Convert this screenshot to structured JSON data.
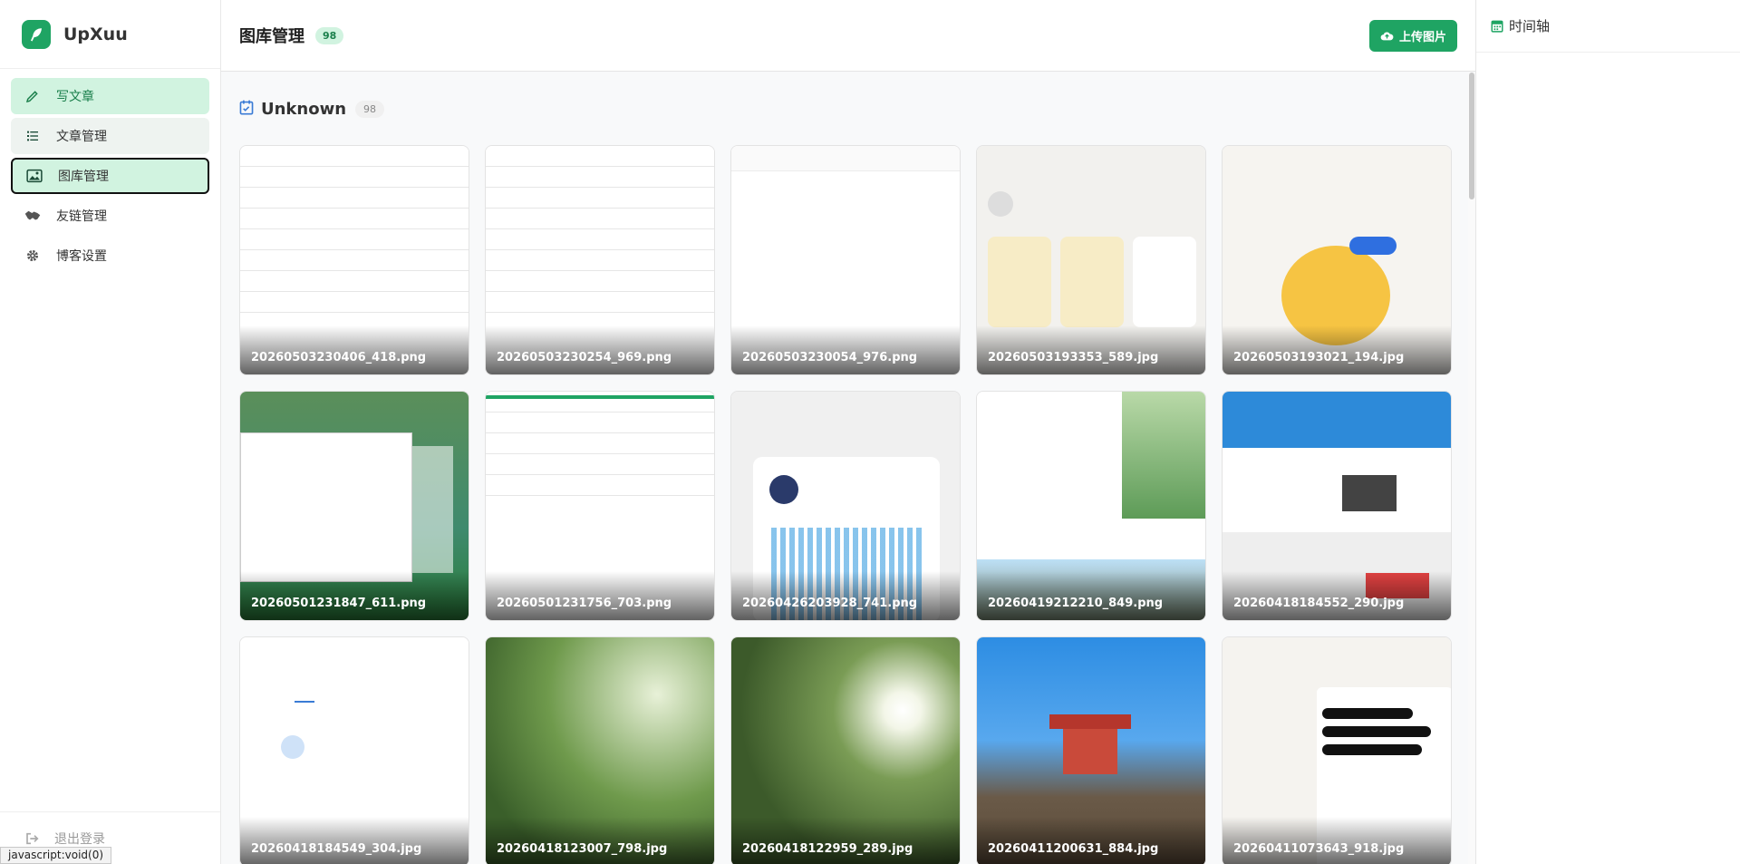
{
  "sidebar": {
    "brand": "UpXuu",
    "items": [
      {
        "label": "写文章",
        "key": "write"
      },
      {
        "label": "文章管理",
        "key": "posts"
      },
      {
        "label": "图库管理",
        "key": "gallery"
      },
      {
        "label": "友链管理",
        "key": "links"
      },
      {
        "label": "博客设置",
        "key": "settings"
      }
    ],
    "logout": "退出登录"
  },
  "statusbar": "javascript:void(0)",
  "header": {
    "title": "图库管理",
    "count": "98",
    "upload_label": "上传图片"
  },
  "group": {
    "title": "Unknown",
    "count": "98"
  },
  "images": [
    {
      "name": "20260503230406_418.png"
    },
    {
      "name": "20260503230254_969.png"
    },
    {
      "name": "20260503230054_976.png"
    },
    {
      "name": "20260503193353_589.jpg"
    },
    {
      "name": "20260503193021_194.jpg"
    },
    {
      "name": "20260501231847_611.png"
    },
    {
      "name": "20260501231756_703.png"
    },
    {
      "name": "20260426203928_741.png"
    },
    {
      "name": "20260419212210_849.png"
    },
    {
      "name": "20260418184552_290.jpg"
    },
    {
      "name": "20260418184549_304.jpg"
    },
    {
      "name": "20260418123007_798.jpg"
    },
    {
      "name": "20260418122959_289.jpg"
    },
    {
      "name": "20260411200631_884.jpg"
    },
    {
      "name": "20260411073643_918.jpg"
    }
  ],
  "timeline": {
    "title": "时间轴"
  },
  "colors": {
    "accent": "#1fa463",
    "accent_light": "#d1f3e0"
  }
}
